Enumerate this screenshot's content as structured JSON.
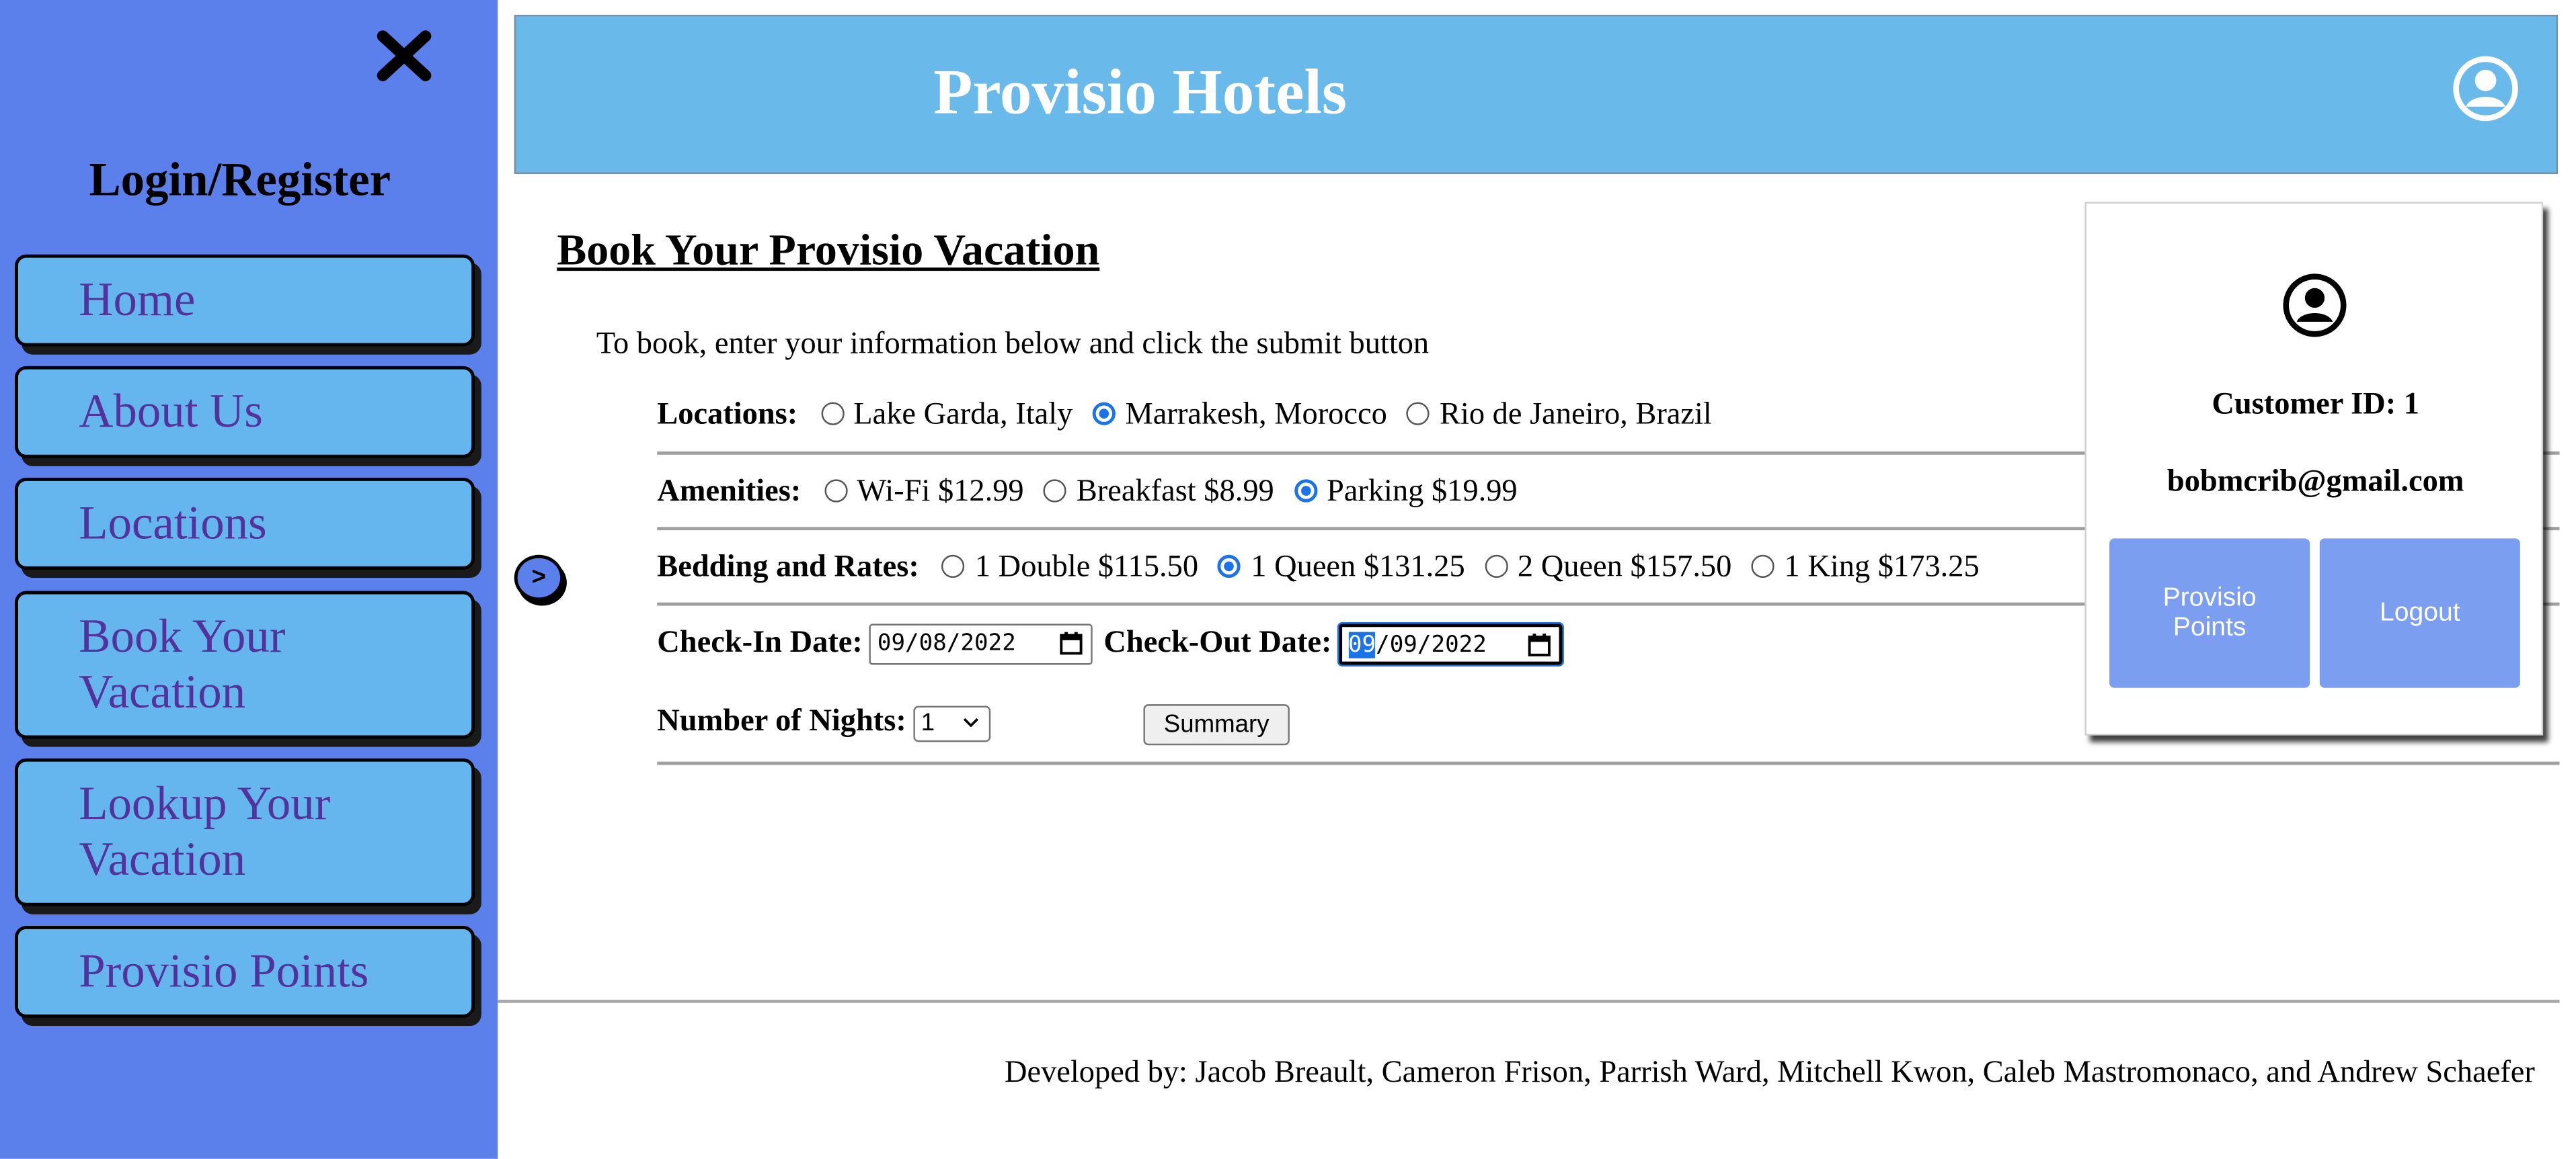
{
  "sidebar": {
    "login_label": "Login/Register",
    "items": [
      {
        "label_lines": [
          "Home"
        ]
      },
      {
        "label_lines": [
          "About Us"
        ]
      },
      {
        "label_lines": [
          "Locations"
        ]
      },
      {
        "label_lines": [
          "Book Your",
          "Vacation"
        ]
      },
      {
        "label_lines": [
          "Lookup Your",
          "Vacation"
        ]
      },
      {
        "label_lines": [
          "Provisio Points"
        ]
      }
    ],
    "icons": {
      "close": "close-x-icon"
    }
  },
  "header": {
    "title": "Provisio Hotels",
    "icons": {
      "account": "user-circle-icon"
    }
  },
  "booking": {
    "title": "Book Your Provisio Vacation",
    "instructions": "To book, enter your information below and click the submit button",
    "locations": {
      "label": "Locations:",
      "options": [
        "Lake Garda, Italy",
        "Marrakesh, Morocco",
        "Rio de Janeiro, Brazil"
      ],
      "selected": "Marrakesh, Morocco"
    },
    "amenities": {
      "label": "Amenities:",
      "options": [
        "Wi-Fi $12.99",
        "Breakfast $8.99",
        "Parking $19.99"
      ],
      "selected": "Parking $19.99"
    },
    "bedding": {
      "label": "Bedding and Rates:",
      "options": [
        "1 Double $115.50",
        "1 Queen $131.25",
        "2 Queen $157.50",
        "1 King $173.25"
      ],
      "selected": "1 Queen $131.25"
    },
    "checkin": {
      "label": "Check-In Date:",
      "month": "09",
      "rest": "/08/2022"
    },
    "checkout": {
      "label": "Check-Out Date:",
      "month": "09",
      "rest": "/09/2022"
    },
    "nights": {
      "label": "Number of Nights:",
      "value": "1"
    },
    "summary_label": "Summary",
    "arrow_label": ">"
  },
  "profile": {
    "customer_id": "Customer ID: 1",
    "email": "bobmcrib@gmail.com",
    "points_lines": [
      "Provisio",
      "Points"
    ],
    "logout_label": "Logout",
    "icons": {
      "avatar": "user-circle-icon"
    }
  },
  "footer": {
    "credits": "Developed by: Jacob Breault, Cameron Frison, Parrish Ward, Mitchell Kwon, Caleb Mastromonaco, and Andrew Schaefer"
  },
  "colors": {
    "sidebar_bg": "#5b80ec",
    "nav_button_bg": "#65b6ee",
    "nav_text": "#53339b",
    "header_bg": "#69b9eb",
    "card_button_bg": "#7b9ef0",
    "radio_checked": "#1a73e8"
  }
}
